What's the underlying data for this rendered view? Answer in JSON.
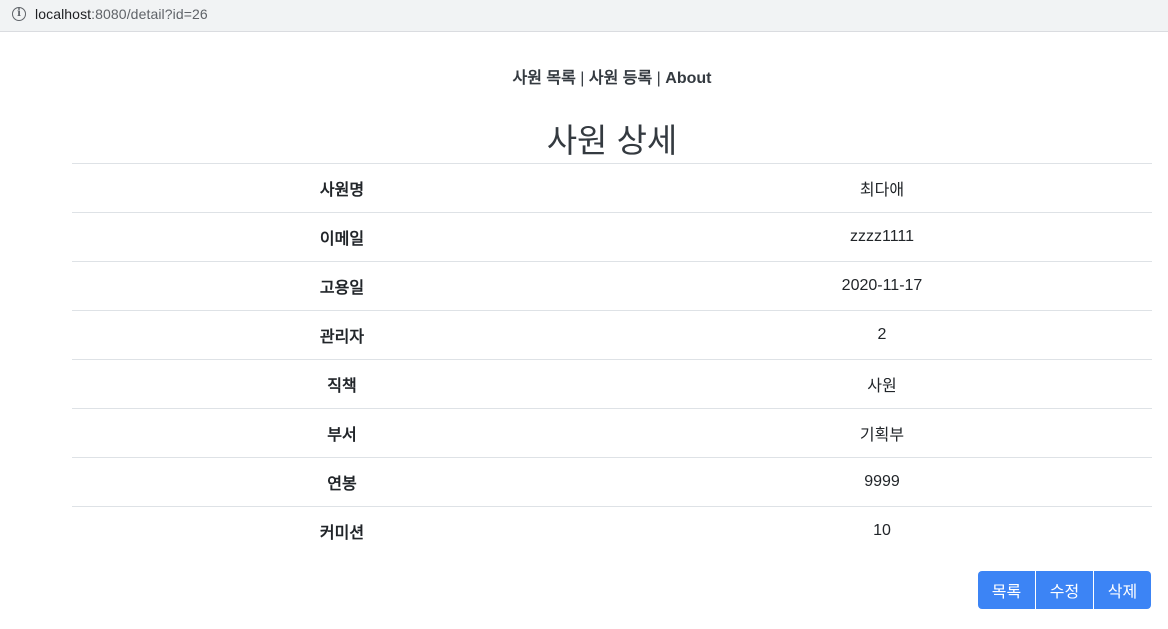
{
  "browser": {
    "host": "localhost",
    "path": ":8080/detail?id=26",
    "info_icon": "info-icon"
  },
  "nav": {
    "items": [
      "사원 목록",
      "사원 등록",
      "About"
    ],
    "separator": "|"
  },
  "page_title": "사원 상세",
  "detail": {
    "rows": [
      {
        "label": "사원명",
        "value": "최다애"
      },
      {
        "label": "이메일",
        "value": "zzzz1111"
      },
      {
        "label": "고용일",
        "value": "2020-11-17"
      },
      {
        "label": "관리자",
        "value": "2"
      },
      {
        "label": "직책",
        "value": "사원"
      },
      {
        "label": "부서",
        "value": "기획부"
      },
      {
        "label": "연봉",
        "value": "9999"
      },
      {
        "label": "커미션",
        "value": "10"
      }
    ]
  },
  "actions": {
    "list_label": "목록",
    "edit_label": "수정",
    "delete_label": "삭제",
    "color": "#3c84f5"
  }
}
